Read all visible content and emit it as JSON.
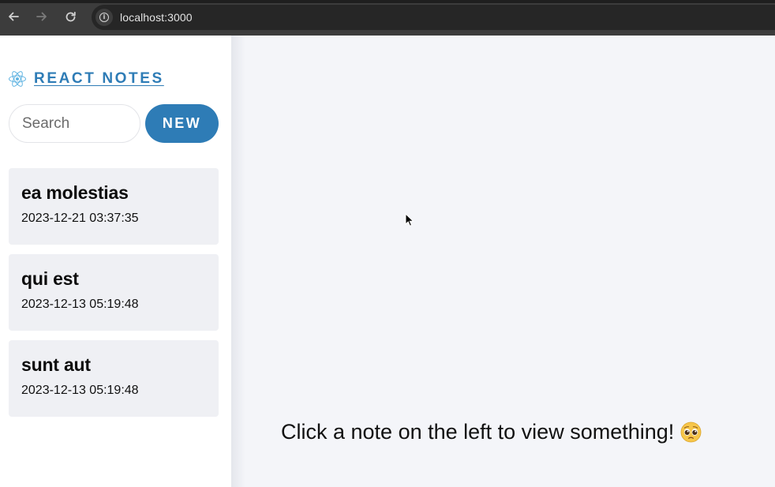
{
  "browser": {
    "url": "localhost:3000",
    "icons": [
      "back-icon",
      "forward-icon",
      "reload-icon",
      "info-icon"
    ]
  },
  "sidebar": {
    "brand": "REACT NOTES",
    "search_placeholder": "Search",
    "new_button": "NEW",
    "notes": [
      {
        "title": "ea molestias",
        "date": "2023-12-21 03:37:35"
      },
      {
        "title": "qui est",
        "date": "2023-12-13 05:19:48"
      },
      {
        "title": "sunt aut",
        "date": "2023-12-13 05:19:48"
      }
    ]
  },
  "main": {
    "empty_message": "Click a note on the left to view something!"
  },
  "colors": {
    "accent": "#2e7cb6",
    "note_bg": "#eff0f4",
    "main_bg": "#f4f5f9"
  }
}
